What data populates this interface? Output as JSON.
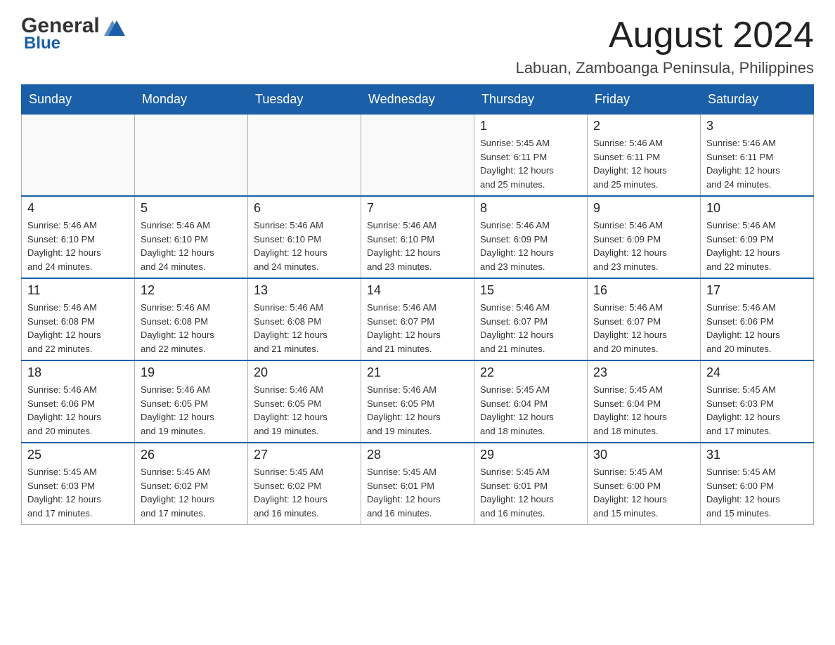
{
  "header": {
    "logo_general": "General",
    "logo_blue": "Blue",
    "month_title": "August 2024",
    "location": "Labuan, Zamboanga Peninsula, Philippines"
  },
  "weekdays": [
    "Sunday",
    "Monday",
    "Tuesday",
    "Wednesday",
    "Thursday",
    "Friday",
    "Saturday"
  ],
  "weeks": [
    [
      {
        "day": "",
        "info": ""
      },
      {
        "day": "",
        "info": ""
      },
      {
        "day": "",
        "info": ""
      },
      {
        "day": "",
        "info": ""
      },
      {
        "day": "1",
        "info": "Sunrise: 5:45 AM\nSunset: 6:11 PM\nDaylight: 12 hours\nand 25 minutes."
      },
      {
        "day": "2",
        "info": "Sunrise: 5:46 AM\nSunset: 6:11 PM\nDaylight: 12 hours\nand 25 minutes."
      },
      {
        "day": "3",
        "info": "Sunrise: 5:46 AM\nSunset: 6:11 PM\nDaylight: 12 hours\nand 24 minutes."
      }
    ],
    [
      {
        "day": "4",
        "info": "Sunrise: 5:46 AM\nSunset: 6:10 PM\nDaylight: 12 hours\nand 24 minutes."
      },
      {
        "day": "5",
        "info": "Sunrise: 5:46 AM\nSunset: 6:10 PM\nDaylight: 12 hours\nand 24 minutes."
      },
      {
        "day": "6",
        "info": "Sunrise: 5:46 AM\nSunset: 6:10 PM\nDaylight: 12 hours\nand 24 minutes."
      },
      {
        "day": "7",
        "info": "Sunrise: 5:46 AM\nSunset: 6:10 PM\nDaylight: 12 hours\nand 23 minutes."
      },
      {
        "day": "8",
        "info": "Sunrise: 5:46 AM\nSunset: 6:09 PM\nDaylight: 12 hours\nand 23 minutes."
      },
      {
        "day": "9",
        "info": "Sunrise: 5:46 AM\nSunset: 6:09 PM\nDaylight: 12 hours\nand 23 minutes."
      },
      {
        "day": "10",
        "info": "Sunrise: 5:46 AM\nSunset: 6:09 PM\nDaylight: 12 hours\nand 22 minutes."
      }
    ],
    [
      {
        "day": "11",
        "info": "Sunrise: 5:46 AM\nSunset: 6:08 PM\nDaylight: 12 hours\nand 22 minutes."
      },
      {
        "day": "12",
        "info": "Sunrise: 5:46 AM\nSunset: 6:08 PM\nDaylight: 12 hours\nand 22 minutes."
      },
      {
        "day": "13",
        "info": "Sunrise: 5:46 AM\nSunset: 6:08 PM\nDaylight: 12 hours\nand 21 minutes."
      },
      {
        "day": "14",
        "info": "Sunrise: 5:46 AM\nSunset: 6:07 PM\nDaylight: 12 hours\nand 21 minutes."
      },
      {
        "day": "15",
        "info": "Sunrise: 5:46 AM\nSunset: 6:07 PM\nDaylight: 12 hours\nand 21 minutes."
      },
      {
        "day": "16",
        "info": "Sunrise: 5:46 AM\nSunset: 6:07 PM\nDaylight: 12 hours\nand 20 minutes."
      },
      {
        "day": "17",
        "info": "Sunrise: 5:46 AM\nSunset: 6:06 PM\nDaylight: 12 hours\nand 20 minutes."
      }
    ],
    [
      {
        "day": "18",
        "info": "Sunrise: 5:46 AM\nSunset: 6:06 PM\nDaylight: 12 hours\nand 20 minutes."
      },
      {
        "day": "19",
        "info": "Sunrise: 5:46 AM\nSunset: 6:05 PM\nDaylight: 12 hours\nand 19 minutes."
      },
      {
        "day": "20",
        "info": "Sunrise: 5:46 AM\nSunset: 6:05 PM\nDaylight: 12 hours\nand 19 minutes."
      },
      {
        "day": "21",
        "info": "Sunrise: 5:46 AM\nSunset: 6:05 PM\nDaylight: 12 hours\nand 19 minutes."
      },
      {
        "day": "22",
        "info": "Sunrise: 5:45 AM\nSunset: 6:04 PM\nDaylight: 12 hours\nand 18 minutes."
      },
      {
        "day": "23",
        "info": "Sunrise: 5:45 AM\nSunset: 6:04 PM\nDaylight: 12 hours\nand 18 minutes."
      },
      {
        "day": "24",
        "info": "Sunrise: 5:45 AM\nSunset: 6:03 PM\nDaylight: 12 hours\nand 17 minutes."
      }
    ],
    [
      {
        "day": "25",
        "info": "Sunrise: 5:45 AM\nSunset: 6:03 PM\nDaylight: 12 hours\nand 17 minutes."
      },
      {
        "day": "26",
        "info": "Sunrise: 5:45 AM\nSunset: 6:02 PM\nDaylight: 12 hours\nand 17 minutes."
      },
      {
        "day": "27",
        "info": "Sunrise: 5:45 AM\nSunset: 6:02 PM\nDaylight: 12 hours\nand 16 minutes."
      },
      {
        "day": "28",
        "info": "Sunrise: 5:45 AM\nSunset: 6:01 PM\nDaylight: 12 hours\nand 16 minutes."
      },
      {
        "day": "29",
        "info": "Sunrise: 5:45 AM\nSunset: 6:01 PM\nDaylight: 12 hours\nand 16 minutes."
      },
      {
        "day": "30",
        "info": "Sunrise: 5:45 AM\nSunset: 6:00 PM\nDaylight: 12 hours\nand 15 minutes."
      },
      {
        "day": "31",
        "info": "Sunrise: 5:45 AM\nSunset: 6:00 PM\nDaylight: 12 hours\nand 15 minutes."
      }
    ]
  ]
}
